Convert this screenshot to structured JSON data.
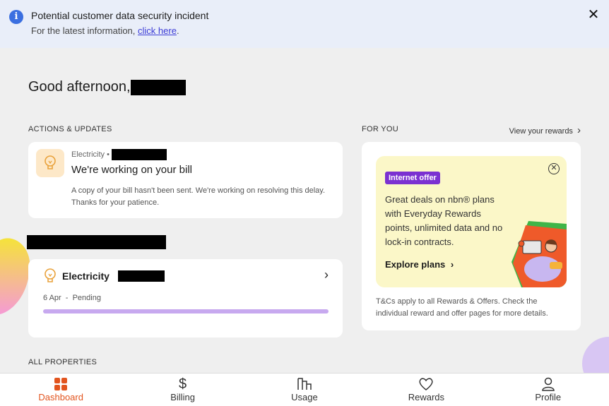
{
  "banner": {
    "title": "Potential customer data security incident",
    "sub_prefix": "For the latest information, ",
    "link_text": "click here",
    "sub_suffix": "."
  },
  "greeting": "Good afternoon,",
  "actions": {
    "heading": "ACTIONS & UPDATES",
    "bill_card": {
      "meta": "Electricity •",
      "title": "We're working on your bill",
      "description": "A copy of your bill hasn't been sent. We're working on resolving this delay. Thanks for your patience."
    },
    "electricity_card": {
      "name": "Electricity",
      "status": "6 Apr  -  Pending",
      "progress": 1.0
    }
  },
  "all_properties": "ALL PROPERTIES",
  "for_you": {
    "heading": "FOR YOU",
    "view_rewards": "View your rewards",
    "promo": {
      "badge": "Internet offer",
      "text": "Great deals on nbn® plans with Everyday Rewards points, unlimited data and no lock-in contracts.",
      "link": "Explore plans"
    },
    "tcs": "T&Cs apply to all Rewards & Offers. Check the individual reward and offer pages for more details."
  },
  "nav": {
    "items": [
      {
        "label": "Dashboard",
        "icon": "grid-icon",
        "active": true
      },
      {
        "label": "Billing",
        "icon": "dollar-icon"
      },
      {
        "label": "Usage",
        "icon": "bars-icon"
      },
      {
        "label": "Rewards",
        "icon": "heart-icon"
      },
      {
        "label": "Profile",
        "icon": "user-icon"
      }
    ]
  },
  "colors": {
    "accent": "#e2541e",
    "badge": "#7b31d1",
    "progress": "#c7a9ef",
    "banner": "#e9eef9"
  }
}
